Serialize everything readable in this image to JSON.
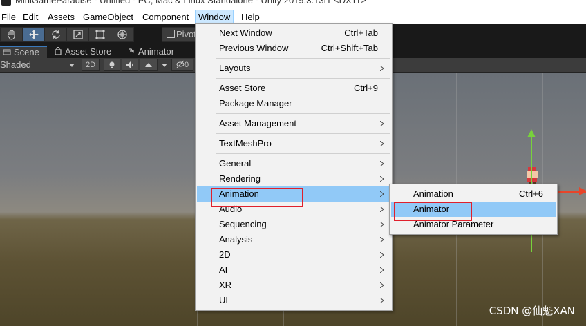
{
  "window": {
    "title": "MiniGameParadise - Untitled - PC, Mac & Linux Standalone - Unity 2019.3.13f1 <DX11>"
  },
  "menubar": {
    "items": [
      "File",
      "Edit",
      "Assets",
      "GameObject",
      "Component",
      "Window",
      "Help"
    ],
    "active": "Window"
  },
  "toolbar": {
    "tools": [
      "hand-tool",
      "move-tool",
      "rotate-tool",
      "scale-tool",
      "rect-tool",
      "transform-tool"
    ],
    "selected_tool": "move-tool",
    "pivot_label": "Pivot"
  },
  "tabs": [
    {
      "label": "Scene",
      "icon": "scene-icon",
      "active": true
    },
    {
      "label": "Asset Store",
      "icon": "asset-store-icon",
      "active": false
    },
    {
      "label": "Animator",
      "icon": "animator-icon",
      "active": false
    }
  ],
  "scene_toolbar": {
    "draw_mode": "Shaded",
    "mode_2d": "2D",
    "hidden_count": "0"
  },
  "window_menu": {
    "items": [
      {
        "label": "Next Window",
        "shortcut": "Ctrl+Tab",
        "submenu": false
      },
      {
        "label": "Previous Window",
        "shortcut": "Ctrl+Shift+Tab",
        "submenu": false
      },
      {
        "label": "Layouts",
        "shortcut": "",
        "submenu": true
      },
      {
        "label": "Asset Store",
        "shortcut": "Ctrl+9",
        "submenu": false
      },
      {
        "label": "Package Manager",
        "shortcut": "",
        "submenu": false
      },
      {
        "label": "Asset Management",
        "shortcut": "",
        "submenu": true
      },
      {
        "label": "TextMeshPro",
        "shortcut": "",
        "submenu": true
      },
      {
        "label": "General",
        "shortcut": "",
        "submenu": true
      },
      {
        "label": "Rendering",
        "shortcut": "",
        "submenu": true
      },
      {
        "label": "Animation",
        "shortcut": "",
        "submenu": true,
        "highlighted": true
      },
      {
        "label": "Audio",
        "shortcut": "",
        "submenu": true
      },
      {
        "label": "Sequencing",
        "shortcut": "",
        "submenu": true
      },
      {
        "label": "Analysis",
        "shortcut": "",
        "submenu": true
      },
      {
        "label": "2D",
        "shortcut": "",
        "submenu": true
      },
      {
        "label": "AI",
        "shortcut": "",
        "submenu": true
      },
      {
        "label": "XR",
        "shortcut": "",
        "submenu": true
      },
      {
        "label": "UI",
        "shortcut": "",
        "submenu": true
      }
    ]
  },
  "animation_submenu": {
    "items": [
      {
        "label": "Animation",
        "shortcut": "Ctrl+6"
      },
      {
        "label": "Animator",
        "shortcut": "",
        "highlighted": true
      },
      {
        "label": "Animator Parameter",
        "shortcut": ""
      }
    ]
  },
  "watermark": "CSDN @仙魁XAN",
  "colors": {
    "highlight": "#91c9f7",
    "annotation_red": "#e0202c",
    "menu_bg": "#f2f2f2",
    "toolbar_bg": "#191919"
  }
}
